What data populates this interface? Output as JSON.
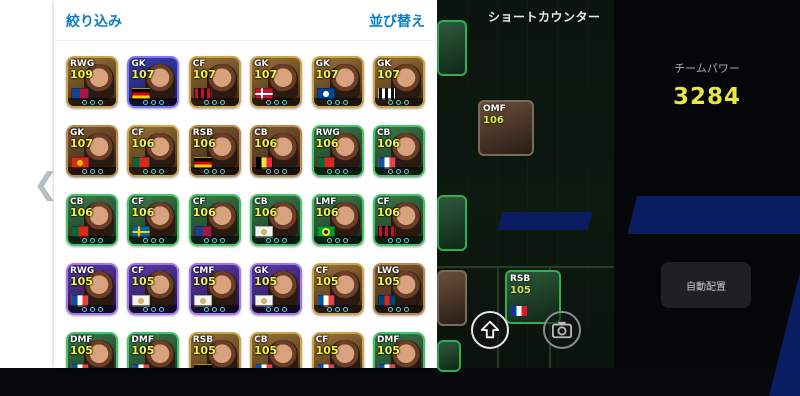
{
  "panel": {
    "filter_label": "絞り込み",
    "sort_label": "並び替え"
  },
  "background": {
    "formation": "ショートカウンター",
    "team_power_label": "チームパワー",
    "team_power_value": "3284",
    "auto_assign_label": "自動配置",
    "bg_cards": [
      {
        "pos": "OMF",
        "rating": "106"
      },
      {
        "pos": "RSB",
        "rating": "105"
      }
    ]
  },
  "colors": {
    "accent": "#0a7dc7",
    "rating_yellow": "#f0f24a",
    "team_power": "#e6e64a"
  },
  "cards": [
    {
      "pos": "RWG",
      "rating": "109",
      "style": "gold",
      "flag": "fcb"
    },
    {
      "pos": "GK",
      "rating": "107",
      "style": "blue",
      "flag": "de"
    },
    {
      "pos": "CF",
      "rating": "107",
      "style": "gold",
      "flag": "acm"
    },
    {
      "pos": "GK",
      "rating": "107",
      "style": "gold",
      "flag": "dk"
    },
    {
      "pos": "GK",
      "rating": "107",
      "style": "gold",
      "flag": "cfc"
    },
    {
      "pos": "GK",
      "rating": "107",
      "style": "gold",
      "flag": "juve"
    },
    {
      "pos": "GK",
      "rating": "107",
      "style": "brown",
      "flag": "mu"
    },
    {
      "pos": "CF",
      "rating": "106",
      "style": "gold",
      "flag": "pt"
    },
    {
      "pos": "RSB",
      "rating": "106",
      "style": "brown",
      "flag": "de"
    },
    {
      "pos": "CB",
      "rating": "106",
      "style": "brown",
      "flag": "be"
    },
    {
      "pos": "RWG",
      "rating": "106",
      "style": "green",
      "flag": "pt"
    },
    {
      "pos": "CB",
      "rating": "106",
      "style": "green",
      "flag": "fr"
    },
    {
      "pos": "CB",
      "rating": "106",
      "style": "green",
      "flag": "pt"
    },
    {
      "pos": "CF",
      "rating": "106",
      "style": "green",
      "flag": "se"
    },
    {
      "pos": "CF",
      "rating": "106",
      "style": "green",
      "flag": "fcb"
    },
    {
      "pos": "CB",
      "rating": "106",
      "style": "green",
      "flag": "rm"
    },
    {
      "pos": "LMF",
      "rating": "106",
      "style": "green",
      "flag": "br"
    },
    {
      "pos": "CF",
      "rating": "106",
      "style": "green",
      "flag": "acm"
    },
    {
      "pos": "RWG",
      "rating": "105",
      "style": "purple",
      "flag": "fr"
    },
    {
      "pos": "CF",
      "rating": "105",
      "style": "purple",
      "flag": "rm"
    },
    {
      "pos": "CMF",
      "rating": "105",
      "style": "purple",
      "flag": "rm"
    },
    {
      "pos": "GK",
      "rating": "105",
      "style": "purple",
      "flag": "rm"
    },
    {
      "pos": "CF",
      "rating": "105",
      "style": "gold",
      "flag": "fr"
    },
    {
      "pos": "LWG",
      "rating": "105",
      "style": "brown",
      "flag": "psg"
    },
    {
      "pos": "DMF",
      "rating": "105",
      "style": "green",
      "flag": "fr"
    },
    {
      "pos": "DMF",
      "rating": "105",
      "style": "green",
      "flag": "fr"
    },
    {
      "pos": "RSB",
      "rating": "105",
      "style": "gold",
      "flag": "de"
    },
    {
      "pos": "CB",
      "rating": "105",
      "style": "gold",
      "flag": "fr"
    },
    {
      "pos": "CF",
      "rating": "105",
      "style": "gold",
      "flag": "fr"
    },
    {
      "pos": "DMF",
      "rating": "105",
      "style": "green",
      "flag": "fr"
    }
  ]
}
